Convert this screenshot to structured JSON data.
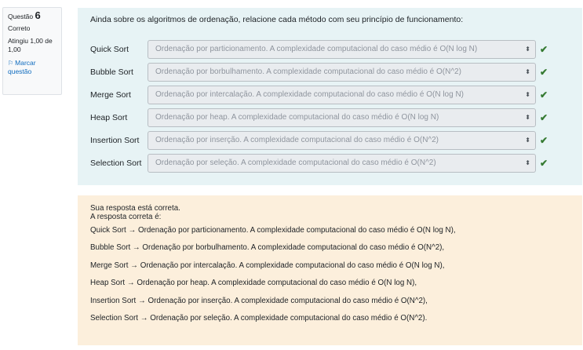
{
  "info": {
    "question_label": "Questão",
    "question_number": "6",
    "state": "Correto",
    "grade": "Atingiu 1,00 de 1,00",
    "flag_label": "Marcar questão"
  },
  "question": {
    "text": "Ainda sobre os algoritmos de ordenação, relacione cada método com seu princípio de funcionamento:",
    "rows": [
      {
        "label": "Quick Sort",
        "selected": "Ordenação por particionamento. A complexidade computacional do caso médio é O(N log N)"
      },
      {
        "label": "Bubble Sort",
        "selected": "Ordenação por borbulhamento. A complexidade computacional do caso médio é O(N^2)"
      },
      {
        "label": "Merge Sort",
        "selected": "Ordenação por intercalação. A complexidade computacional do caso médio é O(N log N)"
      },
      {
        "label": "Heap Sort",
        "selected": "Ordenação por heap. A complexidade computacional do caso médio é O(N log N)"
      },
      {
        "label": "Insertion Sort",
        "selected": "Ordenação por inserção. A complexidade computacional do caso médio é O(N^2)"
      },
      {
        "label": "Selection Sort",
        "selected": "Ordenação por seleção. A complexidade computacional do caso médio é O(N^2)"
      }
    ],
    "check_glyph": "✔",
    "updown_glyph": "⬍"
  },
  "outcome": {
    "feedback": "Sua resposta está correta.",
    "right_intro": "A resposta correta é:",
    "answers": [
      "Quick Sort → Ordenação por particionamento. A complexidade computacional do caso médio é O(N log N),",
      "Bubble Sort → Ordenação por borbulhamento. A complexidade computacional do caso médio é O(N^2),",
      "Merge Sort → Ordenação por intercalação. A complexidade computacional do caso médio é O(N log N),",
      "Heap Sort → Ordenação por heap. A complexidade computacional do caso médio é O(N log N),",
      "Insertion Sort → Ordenação por inserção. A complexidade computacional do caso médio é O(N^2),",
      "Selection Sort → Ordenação por seleção. A complexidade computacional do caso médio é O(N^2)."
    ]
  },
  "colors": {
    "formulation_bg": "#e7f3f5",
    "outcome_bg": "#fcefdc",
    "correct_green": "#357a32",
    "link_blue": "#0f6cbf"
  }
}
